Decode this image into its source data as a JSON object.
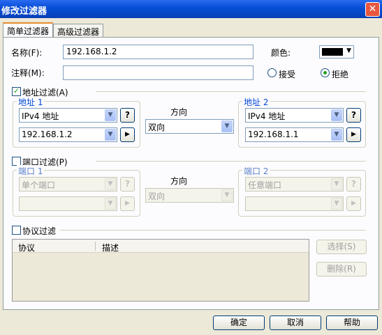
{
  "window": {
    "title": "修改过滤器",
    "close": "✕"
  },
  "tabs": [
    {
      "label": "简单过滤器"
    },
    {
      "label": "高级过滤器"
    }
  ],
  "name": {
    "label": "名称(F):",
    "value": "192.168.1.2"
  },
  "note": {
    "label": "注释(M):",
    "value": ""
  },
  "color": {
    "label": "颜色:",
    "value": "#000000"
  },
  "action": {
    "accept_label": "接受",
    "reject_label": "拒绝",
    "selected": "reject"
  },
  "address_filter": {
    "label": "地址过滤(A)",
    "checked": true,
    "addr1": {
      "title": "地址 1",
      "type": "IPv4 地址",
      "value": "192.168.1.2"
    },
    "direction_label": "方向",
    "direction_value": "双向",
    "addr2": {
      "title": "地址 2",
      "type": "IPv4 地址",
      "value": "192.168.1.1"
    }
  },
  "port_filter": {
    "label": "端口过滤(P)",
    "checked": false,
    "port1": {
      "title": "端口 1",
      "type": "单个端口",
      "value": ""
    },
    "direction_label": "方向",
    "direction_value": "双向",
    "port2": {
      "title": "端口 2",
      "type": "任意端口",
      "value": ""
    }
  },
  "protocol_filter": {
    "label": "协议过滤",
    "checked": false,
    "columns": [
      "协议",
      "描述"
    ],
    "select_button": "选择(S)",
    "delete_button": "删除(R)"
  },
  "footer": {
    "ok": "确定",
    "cancel": "取消",
    "help": "帮助"
  },
  "glyphs": {
    "question": "?",
    "arrow_right": "▶",
    "dropdown": "▼",
    "check": "✓"
  }
}
